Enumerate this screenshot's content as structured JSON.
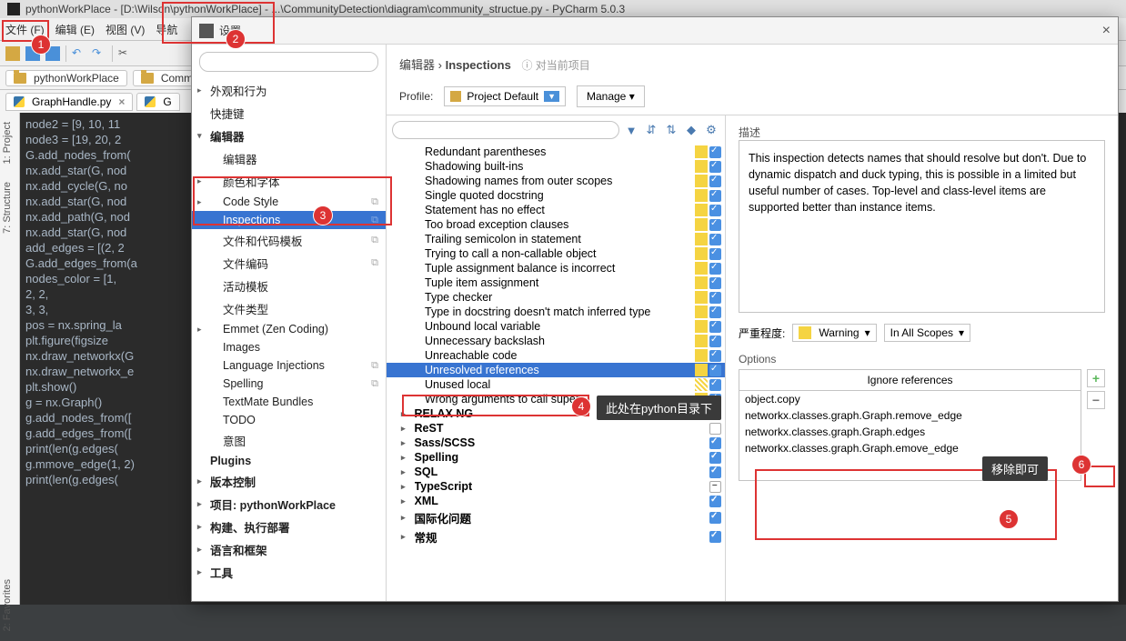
{
  "window": {
    "title": "pythonWorkPlace - [D:\\Wilson\\pythonWorkPlace] - ...\\CommunityDetection\\diagram\\community_structue.py - PyCharm 5.0.3"
  },
  "menu": [
    "文件 (F)",
    "编辑 (E)",
    "视图 (V)",
    "导航"
  ],
  "breadcrumb": [
    "pythonWorkPlace",
    "Comm"
  ],
  "tabs": [
    {
      "name": "GraphHandle.py"
    },
    {
      "name": "G"
    }
  ],
  "code_lines": [
    "node2 = [9, 10, 11",
    "node3 = [19, 20, 2",
    "G.add_nodes_from(",
    "nx.add_star(G, nod",
    "nx.add_cycle(G, no",
    "nx.add_star(G, nod",
    "nx.add_path(G, nod",
    "nx.add_star(G, nod",
    "add_edges = [(2, 2",
    "G.add_edges_from(a",
    "nodes_color = [1,",
    "             2, 2,",
    "             3, 3,",
    "pos = nx.spring_la",
    "plt.figure(figsize",
    "nx.draw_networkx(G",
    "nx.draw_networkx_e",
    "",
    "plt.show()",
    "",
    "g = nx.Graph()",
    "g.add_nodes_from([",
    "g.add_edges_from([",
    "print(len(g.edges(",
    "g.mmove_edge(1, 2)",
    "print(len(g.edges("
  ],
  "side_tabs": [
    "1: Project",
    "7: Structure",
    "2: Favorites"
  ],
  "dialog": {
    "title": "设置",
    "breadcrumb": {
      "a": "编辑器",
      "b": "Inspections",
      "note": "对当前项目"
    },
    "profile_label": "Profile:",
    "profile_value": "Project Default",
    "manage_btn": "Manage",
    "tree": [
      {
        "label": "外观和行为",
        "arrow": "▸"
      },
      {
        "label": "快捷键"
      },
      {
        "label": "编辑器",
        "arrow": "▾",
        "bold": true
      },
      {
        "label": "编辑器",
        "sub": true
      },
      {
        "label": "颜色和字体",
        "sub": true,
        "arrow": "▸"
      },
      {
        "label": "Code Style",
        "sub": true,
        "arrow": "▸",
        "copy": true
      },
      {
        "label": "Inspections",
        "sub": true,
        "selected": true,
        "copy": true
      },
      {
        "label": "文件和代码模板",
        "sub": true,
        "copy": true
      },
      {
        "label": "文件编码",
        "sub": true,
        "copy": true
      },
      {
        "label": "活动模板",
        "sub": true
      },
      {
        "label": "文件类型",
        "sub": true
      },
      {
        "label": "Emmet (Zen Coding)",
        "sub": true,
        "arrow": "▸"
      },
      {
        "label": "Images",
        "sub": true
      },
      {
        "label": "Language Injections",
        "sub": true,
        "copy": true
      },
      {
        "label": "Spelling",
        "sub": true,
        "copy": true
      },
      {
        "label": "TextMate Bundles",
        "sub": true
      },
      {
        "label": "TODO",
        "sub": true
      },
      {
        "label": "意图",
        "sub": true
      },
      {
        "label": "Plugins",
        "bold": true
      },
      {
        "label": "版本控制",
        "arrow": "▸",
        "bold": true
      },
      {
        "label": "项目: pythonWorkPlace",
        "arrow": "▸",
        "bold": true
      },
      {
        "label": "构建、执行部署",
        "arrow": "▸",
        "bold": true
      },
      {
        "label": "语言和框架",
        "arrow": "▸",
        "bold": true
      },
      {
        "label": "工具",
        "arrow": "▸",
        "bold": true
      }
    ],
    "inspections": [
      {
        "label": "Redundant parentheses",
        "sev": "y",
        "chk": true
      },
      {
        "label": "Shadowing built-ins",
        "sev": "y",
        "chk": true
      },
      {
        "label": "Shadowing names from outer scopes",
        "sev": "y",
        "chk": true
      },
      {
        "label": "Single quoted docstring",
        "sev": "y",
        "chk": true
      },
      {
        "label": "Statement has no effect",
        "sev": "y",
        "chk": true
      },
      {
        "label": "Too broad exception clauses",
        "sev": "y",
        "chk": true
      },
      {
        "label": "Trailing semicolon in statement",
        "sev": "y",
        "chk": true
      },
      {
        "label": "Trying to call a non-callable object",
        "sev": "y",
        "chk": true
      },
      {
        "label": "Tuple assignment balance is incorrect",
        "sev": "y",
        "chk": true
      },
      {
        "label": "Tuple item assignment",
        "sev": "y",
        "chk": true
      },
      {
        "label": "Type checker",
        "sev": "y",
        "chk": true
      },
      {
        "label": "Type in docstring doesn't match inferred type",
        "sev": "y",
        "chk": true
      },
      {
        "label": "Unbound local variable",
        "sev": "y",
        "chk": true
      },
      {
        "label": "Unnecessary backslash",
        "sev": "y",
        "chk": true
      },
      {
        "label": "Unreachable code",
        "sev": "y",
        "chk": true
      },
      {
        "label": "Unresolved references",
        "sev": "y",
        "chk": true,
        "selected": true
      },
      {
        "label": "Unused local",
        "sev": "striked",
        "chk": true
      },
      {
        "label": "Wrong arguments to call super",
        "sev": "y",
        "chk": true
      },
      {
        "label": "RELAX NG",
        "bold": true,
        "sev": "r",
        "chk": "dash",
        "arrow": "▸"
      },
      {
        "label": "ReST",
        "bold": true,
        "chk": "empty",
        "arrow": "▸"
      },
      {
        "label": "Sass/SCSS",
        "bold": true,
        "chk": true,
        "arrow": "▸"
      },
      {
        "label": "Spelling",
        "bold": true,
        "chk": true,
        "arrow": "▸"
      },
      {
        "label": "SQL",
        "bold": true,
        "chk": true,
        "arrow": "▸"
      },
      {
        "label": "TypeScript",
        "bold": true,
        "chk": "dash",
        "arrow": "▸"
      },
      {
        "label": "XML",
        "bold": true,
        "chk": true,
        "arrow": "▸"
      },
      {
        "label": "国际化问题",
        "bold": true,
        "chk": true,
        "arrow": "▸"
      },
      {
        "label": "常规",
        "bold": true,
        "arrow": "▸"
      }
    ],
    "desc_label": "描述",
    "description": "This inspection detects names that should resolve but don't. Due to dynamic dispatch and duck typing, this is possible in a limited but useful number of cases. Top-level and class-level items are supported better than instance items.",
    "severity_label": "严重程度:",
    "severity_value": "Warning",
    "scopes_value": "In All Scopes",
    "options_label": "Options",
    "ignore_header": "Ignore references",
    "ignore_list": [
      "object.copy",
      "networkx.classes.graph.Graph.remove_edge",
      "networkx.classes.graph.Graph.edges",
      "networkx.classes.graph.Graph.emove_edge"
    ]
  },
  "tooltips": {
    "t1": "此处在python目录下",
    "t2": "移除即可"
  }
}
